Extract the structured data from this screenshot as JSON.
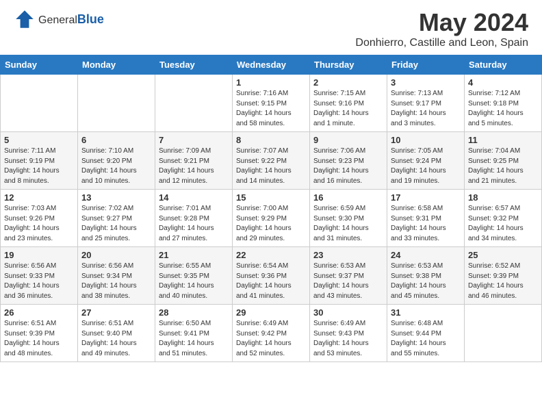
{
  "header": {
    "logo_general": "General",
    "logo_blue": "Blue",
    "month_title": "May 2024",
    "location": "Donhierro, Castille and Leon, Spain"
  },
  "calendar": {
    "days_of_week": [
      "Sunday",
      "Monday",
      "Tuesday",
      "Wednesday",
      "Thursday",
      "Friday",
      "Saturday"
    ],
    "weeks": [
      {
        "cells": [
          {
            "day": "",
            "info": ""
          },
          {
            "day": "",
            "info": ""
          },
          {
            "day": "",
            "info": ""
          },
          {
            "day": "1",
            "info": "Sunrise: 7:16 AM\nSunset: 9:15 PM\nDaylight: 14 hours\nand 58 minutes."
          },
          {
            "day": "2",
            "info": "Sunrise: 7:15 AM\nSunset: 9:16 PM\nDaylight: 14 hours\nand 1 minute."
          },
          {
            "day": "3",
            "info": "Sunrise: 7:13 AM\nSunset: 9:17 PM\nDaylight: 14 hours\nand 3 minutes."
          },
          {
            "day": "4",
            "info": "Sunrise: 7:12 AM\nSunset: 9:18 PM\nDaylight: 14 hours\nand 5 minutes."
          }
        ]
      },
      {
        "cells": [
          {
            "day": "5",
            "info": "Sunrise: 7:11 AM\nSunset: 9:19 PM\nDaylight: 14 hours\nand 8 minutes."
          },
          {
            "day": "6",
            "info": "Sunrise: 7:10 AM\nSunset: 9:20 PM\nDaylight: 14 hours\nand 10 minutes."
          },
          {
            "day": "7",
            "info": "Sunrise: 7:09 AM\nSunset: 9:21 PM\nDaylight: 14 hours\nand 12 minutes."
          },
          {
            "day": "8",
            "info": "Sunrise: 7:07 AM\nSunset: 9:22 PM\nDaylight: 14 hours\nand 14 minutes."
          },
          {
            "day": "9",
            "info": "Sunrise: 7:06 AM\nSunset: 9:23 PM\nDaylight: 14 hours\nand 16 minutes."
          },
          {
            "day": "10",
            "info": "Sunrise: 7:05 AM\nSunset: 9:24 PM\nDaylight: 14 hours\nand 19 minutes."
          },
          {
            "day": "11",
            "info": "Sunrise: 7:04 AM\nSunset: 9:25 PM\nDaylight: 14 hours\nand 21 minutes."
          }
        ]
      },
      {
        "cells": [
          {
            "day": "12",
            "info": "Sunrise: 7:03 AM\nSunset: 9:26 PM\nDaylight: 14 hours\nand 23 minutes."
          },
          {
            "day": "13",
            "info": "Sunrise: 7:02 AM\nSunset: 9:27 PM\nDaylight: 14 hours\nand 25 minutes."
          },
          {
            "day": "14",
            "info": "Sunrise: 7:01 AM\nSunset: 9:28 PM\nDaylight: 14 hours\nand 27 minutes."
          },
          {
            "day": "15",
            "info": "Sunrise: 7:00 AM\nSunset: 9:29 PM\nDaylight: 14 hours\nand 29 minutes."
          },
          {
            "day": "16",
            "info": "Sunrise: 6:59 AM\nSunset: 9:30 PM\nDaylight: 14 hours\nand 31 minutes."
          },
          {
            "day": "17",
            "info": "Sunrise: 6:58 AM\nSunset: 9:31 PM\nDaylight: 14 hours\nand 33 minutes."
          },
          {
            "day": "18",
            "info": "Sunrise: 6:57 AM\nSunset: 9:32 PM\nDaylight: 14 hours\nand 34 minutes."
          }
        ]
      },
      {
        "cells": [
          {
            "day": "19",
            "info": "Sunrise: 6:56 AM\nSunset: 9:33 PM\nDaylight: 14 hours\nand 36 minutes."
          },
          {
            "day": "20",
            "info": "Sunrise: 6:56 AM\nSunset: 9:34 PM\nDaylight: 14 hours\nand 38 minutes."
          },
          {
            "day": "21",
            "info": "Sunrise: 6:55 AM\nSunset: 9:35 PM\nDaylight: 14 hours\nand 40 minutes."
          },
          {
            "day": "22",
            "info": "Sunrise: 6:54 AM\nSunset: 9:36 PM\nDaylight: 14 hours\nand 41 minutes."
          },
          {
            "day": "23",
            "info": "Sunrise: 6:53 AM\nSunset: 9:37 PM\nDaylight: 14 hours\nand 43 minutes."
          },
          {
            "day": "24",
            "info": "Sunrise: 6:53 AM\nSunset: 9:38 PM\nDaylight: 14 hours\nand 45 minutes."
          },
          {
            "day": "25",
            "info": "Sunrise: 6:52 AM\nSunset: 9:39 PM\nDaylight: 14 hours\nand 46 minutes."
          }
        ]
      },
      {
        "cells": [
          {
            "day": "26",
            "info": "Sunrise: 6:51 AM\nSunset: 9:39 PM\nDaylight: 14 hours\nand 48 minutes."
          },
          {
            "day": "27",
            "info": "Sunrise: 6:51 AM\nSunset: 9:40 PM\nDaylight: 14 hours\nand 49 minutes."
          },
          {
            "day": "28",
            "info": "Sunrise: 6:50 AM\nSunset: 9:41 PM\nDaylight: 14 hours\nand 51 minutes."
          },
          {
            "day": "29",
            "info": "Sunrise: 6:49 AM\nSunset: 9:42 PM\nDaylight: 14 hours\nand 52 minutes."
          },
          {
            "day": "30",
            "info": "Sunrise: 6:49 AM\nSunset: 9:43 PM\nDaylight: 14 hours\nand 53 minutes."
          },
          {
            "day": "31",
            "info": "Sunrise: 6:48 AM\nSunset: 9:44 PM\nDaylight: 14 hours\nand 55 minutes."
          },
          {
            "day": "",
            "info": ""
          }
        ]
      }
    ]
  }
}
